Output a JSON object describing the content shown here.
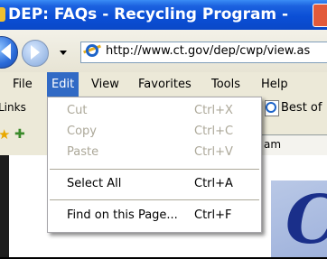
{
  "window": {
    "title": "DEP: FAQs - Recycling Program -"
  },
  "address_bar": {
    "url": "http://www.ct.gov/dep/cwp/view.as"
  },
  "menubar": {
    "items": [
      {
        "label": "File"
      },
      {
        "label": "Edit"
      },
      {
        "label": "View"
      },
      {
        "label": "Favorites"
      },
      {
        "label": "Tools"
      },
      {
        "label": "Help"
      }
    ]
  },
  "links_bar": {
    "label": "Links",
    "item": "Best of"
  },
  "tab": {
    "label": "am"
  },
  "edit_menu": {
    "items": [
      {
        "label": "Cut",
        "shortcut": "Ctrl+X"
      },
      {
        "label": "Copy",
        "shortcut": "Ctrl+C"
      },
      {
        "label": "Paste",
        "shortcut": "Ctrl+V"
      },
      {
        "label": "Select All",
        "shortcut": "Ctrl+A"
      },
      {
        "label": "Find on this Page...",
        "shortcut": "Ctrl+F"
      }
    ]
  },
  "page": {
    "logo_letter": "C"
  },
  "colors": {
    "title_bar": "#0b4fd6",
    "menu_highlight": "#316ac5",
    "disabled_text": "#aca899"
  }
}
